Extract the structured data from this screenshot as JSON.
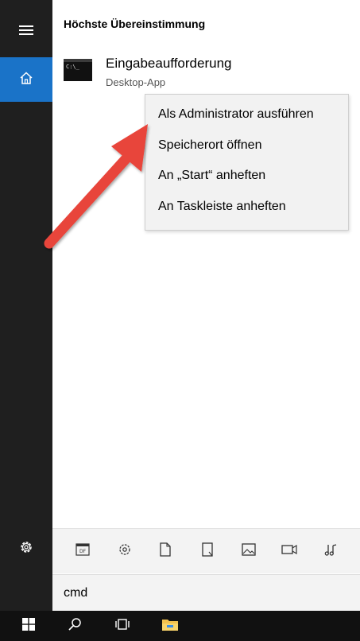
{
  "search_panel": {
    "best_match_heading": "Höchste Übereinstimmung",
    "result": {
      "name": "Eingabeaufforderung",
      "subtitle": "Desktop-App",
      "icon": "command-prompt-icon",
      "icon_text": "C:\\_"
    }
  },
  "context_menu": {
    "items": [
      {
        "label": "Als Administrator ausführen"
      },
      {
        "label": "Speicherort öffnen"
      },
      {
        "label": "An „Start“ anheften"
      },
      {
        "label": "An Taskleiste anheften"
      }
    ]
  },
  "left_rail": {
    "items": [
      "hamburger-menu-icon",
      "home-icon",
      "settings-gear-icon"
    ]
  },
  "filter_bar": {
    "items": [
      "apps-icon",
      "settings-icon",
      "documents-icon",
      "folders-icon",
      "photos-icon",
      "videos-icon",
      "music-icon"
    ]
  },
  "search_box": {
    "value": "cmd"
  },
  "taskbar": {
    "items": [
      "windows-start-icon",
      "search-icon",
      "task-view-icon",
      "file-explorer-icon"
    ]
  },
  "colors": {
    "rail_background": "#1f1f1f",
    "accent_blue": "#1a73c8",
    "arrow_red": "#e8443a",
    "menu_background": "#f2f2f2",
    "taskbar_background": "#111111"
  }
}
